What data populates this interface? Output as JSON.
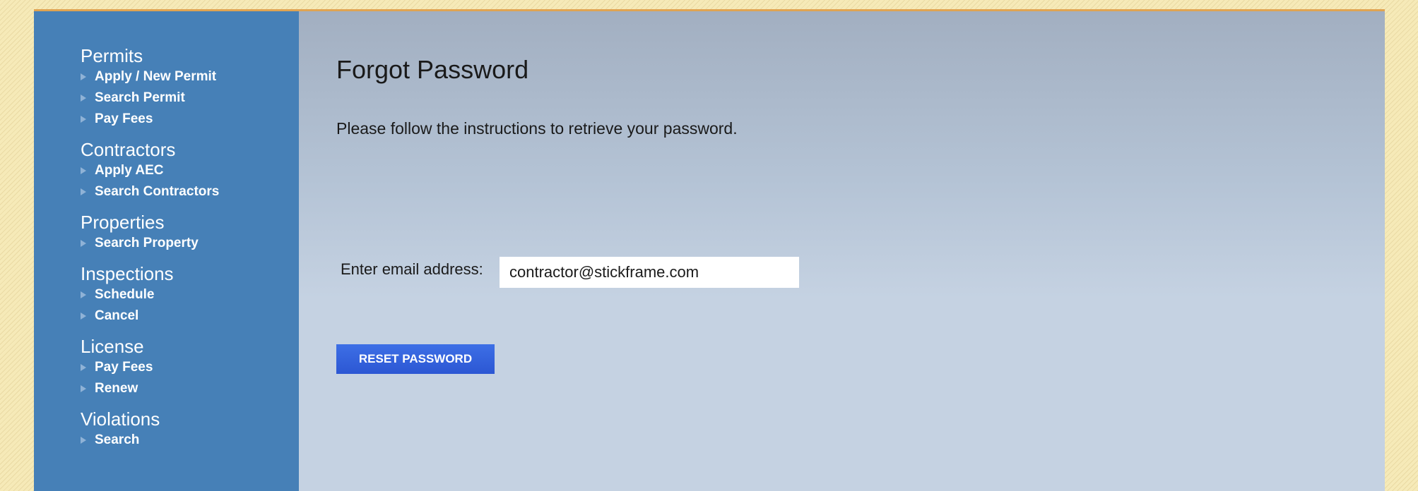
{
  "sidebar": {
    "groups": [
      {
        "heading": "Permits",
        "items": [
          "Apply / New Permit",
          "Search Permit",
          "Pay Fees"
        ]
      },
      {
        "heading": "Contractors",
        "items": [
          "Apply AEC",
          "Search Contractors"
        ]
      },
      {
        "heading": "Properties",
        "items": [
          "Search Property"
        ]
      },
      {
        "heading": "Inspections",
        "items": [
          "Schedule",
          "Cancel"
        ]
      },
      {
        "heading": "License",
        "items": [
          "Pay Fees",
          "Renew"
        ]
      },
      {
        "heading": "Violations",
        "items": [
          "Search"
        ]
      }
    ]
  },
  "main": {
    "title": "Forgot Password",
    "instructions": "Please follow the instructions to retrieve your password.",
    "email_label": "Enter email address:",
    "email_value": "contractor@stickframe.com",
    "reset_button_label": "RESET PASSWORD"
  },
  "colors": {
    "sidebar_bg": "#4680b7",
    "button_bg": "#2f5ed8",
    "top_border": "#e0a452",
    "outer_bg": "#f6eab8"
  }
}
